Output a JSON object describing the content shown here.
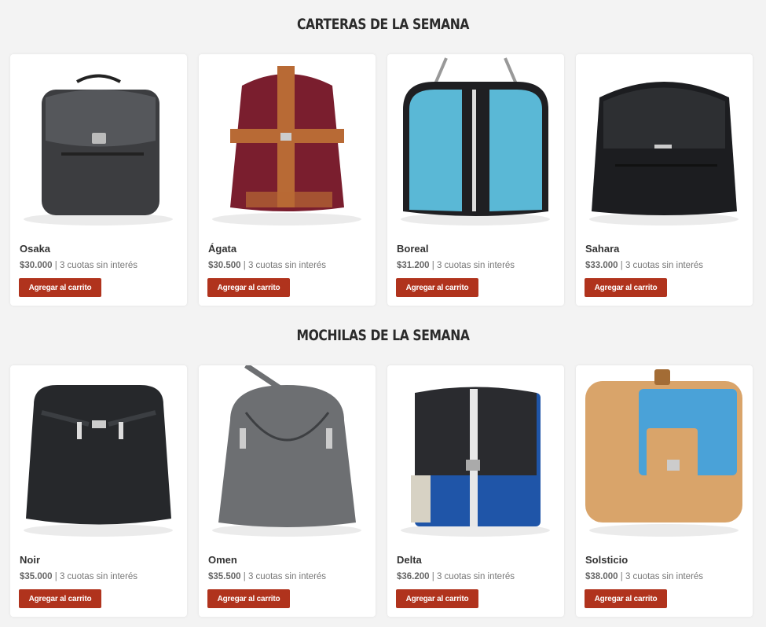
{
  "sections": [
    {
      "title": "CARTERAS DE LA SEMANA",
      "products": [
        {
          "name": "Osaka",
          "price": "$30.000",
          "installments": "3 cuotas sin interés",
          "button": "Agregar al carrito",
          "colors": {
            "body": "#3c3d40",
            "accent": "#55575b"
          }
        },
        {
          "name": "Ágata",
          "price": "$30.500",
          "installments": "3 cuotas sin interés",
          "button": "Agregar al carrito",
          "colors": {
            "body": "#7a1e2e",
            "accent": "#b86a35"
          }
        },
        {
          "name": "Boreal",
          "price": "$31.200",
          "installments": "3 cuotas sin interés",
          "button": "Agregar al carrito",
          "colors": {
            "body": "#5ab8d6",
            "accent": "#1f1f22"
          }
        },
        {
          "name": "Sahara",
          "price": "$33.000",
          "installments": "3 cuotas sin interés",
          "button": "Agregar al carrito",
          "colors": {
            "body": "#1c1d20",
            "accent": "#35373b"
          }
        }
      ]
    },
    {
      "title": "MOCHILAS DE LA SEMANA",
      "products": [
        {
          "name": "Noir",
          "price": "$35.000",
          "installments": "3 cuotas sin interés",
          "button": "Agregar al carrito",
          "colors": {
            "body": "#26282b",
            "accent": "#3b3e42"
          }
        },
        {
          "name": "Omen",
          "price": "$35.500",
          "installments": "3 cuotas sin interés",
          "button": "Agregar al carrito",
          "colors": {
            "body": "#6d6f72",
            "accent": "#3d3f42"
          }
        },
        {
          "name": "Delta",
          "price": "$36.200",
          "installments": "3 cuotas sin interés",
          "button": "Agregar al carrito",
          "colors": {
            "body": "#1f55a8",
            "accent": "#2a2b2f"
          }
        },
        {
          "name": "Solsticio",
          "price": "$38.000",
          "installments": "3 cuotas sin interés",
          "button": "Agregar al carrito",
          "colors": {
            "body": "#d9a46a",
            "accent": "#4aa2d8"
          }
        }
      ]
    }
  ],
  "separator": " | ",
  "theme": {
    "button_bg": "#b0331d",
    "page_bg": "#f3f3f3"
  }
}
